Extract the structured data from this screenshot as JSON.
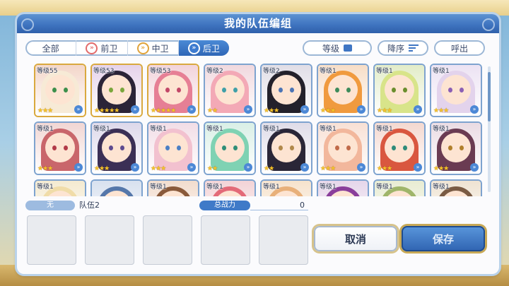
{
  "dialog": {
    "title": "我的队伍编组"
  },
  "tabs": [
    {
      "label": "全部",
      "icon": null,
      "active": false
    },
    {
      "label": "前卫",
      "icon": "red-chevron-icon",
      "active": false
    },
    {
      "label": "中卫",
      "icon": "gold-chevron-icon",
      "active": false
    },
    {
      "label": "后卫",
      "icon": "blue-chevron-icon",
      "active": true
    }
  ],
  "controls": {
    "level_sort": "等级",
    "order": "降序",
    "call": "呼出"
  },
  "characters": [
    {
      "level": "等级55",
      "stars": "★★★",
      "bg": "#f3d6c9",
      "hair": "#f7ead6",
      "eye": "#3d8f4b",
      "gold": true
    },
    {
      "level": "等级53",
      "stars": "★★★★★",
      "bg": "#e5d2ea",
      "hair": "#2b2438",
      "eye": "#7aa63c",
      "gold": true
    },
    {
      "level": "等级53",
      "stars": "★★★★★",
      "bg": "#f2d3da",
      "hair": "#e67f95",
      "eye": "#c24768",
      "gold": true
    },
    {
      "level": "等级2",
      "stars": "★★",
      "bg": "#f0d8de",
      "hair": "#f3a9b6",
      "eye": "#3fa0a8",
      "gold": false
    },
    {
      "level": "等级2",
      "stars": "★★★",
      "bg": "#e0dde6",
      "hair": "#23212b",
      "eye": "#4c74b5",
      "gold": false
    },
    {
      "level": "等级1",
      "stars": "★★★",
      "bg": "#f7ddc6",
      "hair": "#f09a3e",
      "eye": "#3e8b5a",
      "gold": false
    },
    {
      "level": "等级1",
      "stars": "★★★",
      "bg": "#e2ecc8",
      "hair": "#d8e48a",
      "eye": "#6a8e2d",
      "gold": false
    },
    {
      "level": "等级1",
      "stars": "★★★",
      "bg": "#ece2f3",
      "hair": "#e3d3ec",
      "eye": "#8b5fb4",
      "gold": false
    },
    {
      "level": "等级1",
      "stars": "★★★",
      "bg": "#f1d6d3",
      "hair": "#c9666b",
      "eye": "#b23a48",
      "gold": false
    },
    {
      "level": "等级1",
      "stars": "★★★",
      "bg": "#ddd8ea",
      "hair": "#3b2f55",
      "eye": "#5e4a8f",
      "gold": false
    },
    {
      "level": "等级1",
      "stars": "★★★",
      "bg": "#f2dde6",
      "hair": "#f2c1cf",
      "eye": "#4b7fc4",
      "gold": false
    },
    {
      "level": "等级1",
      "stars": "★★",
      "bg": "#d9efe6",
      "hair": "#7fd2b3",
      "eye": "#2f8e78",
      "gold": false
    },
    {
      "level": "等级1",
      "stars": "★★",
      "bg": "#dfdce8",
      "hair": "#2a2637",
      "eye": "#b1884a",
      "gold": false
    },
    {
      "level": "等级1",
      "stars": "★★★",
      "bg": "#f8e0d4",
      "hair": "#f2b79c",
      "eye": "#c06a4a",
      "gold": false
    },
    {
      "level": "等级1",
      "stars": "★★★",
      "bg": "#f4d8cf",
      "hair": "#d9573f",
      "eye": "#2f8b79",
      "gold": false
    },
    {
      "level": "等级1",
      "stars": "★★★",
      "bg": "#eadbe3",
      "hair": "#6a3b52",
      "eye": "#b07f2b",
      "gold": false
    },
    {
      "level": "等级1",
      "stars": "",
      "bg": "#f4ead0",
      "hair": "#f0dca8",
      "eye": "#777777",
      "gold": false
    },
    {
      "level": "",
      "stars": "",
      "bg": "#d8e1ef",
      "hair": "#5577aa",
      "eye": "#777777",
      "gold": false
    },
    {
      "level": "等级1",
      "stars": "",
      "bg": "#f2dccd",
      "hair": "#8a5a3b",
      "eye": "#777777",
      "gold": false
    },
    {
      "level": "等级1",
      "stars": "",
      "bg": "#f3d3d6",
      "hair": "#e36a78",
      "eye": "#777777",
      "gold": false
    },
    {
      "level": "等级1",
      "stars": "",
      "bg": "#f6e2cc",
      "hair": "#e8b07a",
      "eye": "#777777",
      "gold": false
    },
    {
      "level": "等级1",
      "stars": "",
      "bg": "#e6d6ea",
      "hair": "#8a3e9b",
      "eye": "#777777",
      "gold": false
    },
    {
      "level": "等级1",
      "stars": "",
      "bg": "#e8ecd2",
      "hair": "#9fb56a",
      "eye": "#777777",
      "gold": false
    },
    {
      "level": "等级1",
      "stars": "",
      "bg": "#efe3d2",
      "hair": "#7a5b44",
      "eye": "#777777",
      "gold": false
    }
  ],
  "team": {
    "tag": "无",
    "name": "队伍2",
    "power_label": "总战力",
    "power_value": "0"
  },
  "buttons": {
    "cancel": "取消",
    "save": "保存"
  },
  "colors": {
    "accent": "#3f74c0",
    "gold_frame": "#d9a93e",
    "frame": "#7ea3cf"
  }
}
